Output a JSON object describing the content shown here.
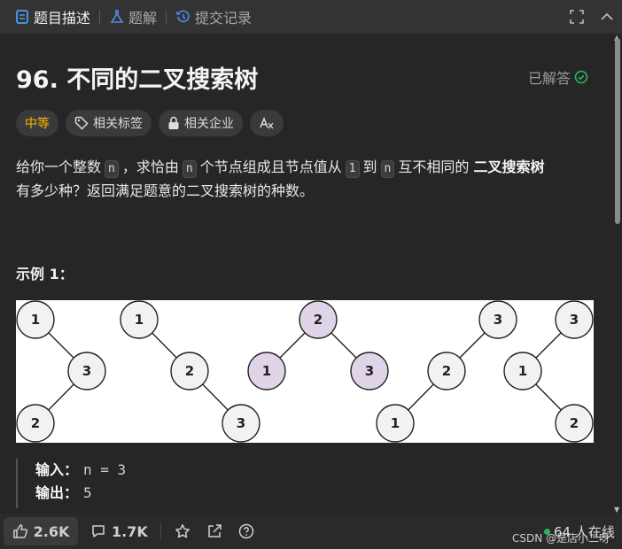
{
  "tabs": [
    {
      "label": "题目描述",
      "icon": "document-icon",
      "active": true
    },
    {
      "label": "题解",
      "icon": "flask-icon",
      "active": false
    },
    {
      "label": "提交记录",
      "icon": "history-icon",
      "active": false
    }
  ],
  "problem": {
    "title": "96. 不同的二叉搜索树",
    "status": "已解答",
    "tags": {
      "difficulty": "中等",
      "related_tags": "相关标签",
      "related_companies": "相关企业"
    },
    "description": {
      "p1": "给你一个整数",
      "n": "n",
      "p2": "，求恰由",
      "p3": "个节点组成且节点值从",
      "one": "1",
      "p4": "到",
      "p5": "互不相同的",
      "bold": "二叉搜索树",
      "p6": "有多少种？返回满足题意的二叉搜索树的种数。"
    },
    "example_title": "示例 1：",
    "figure_nodes": [
      "1",
      "3",
      "2",
      "1",
      "2",
      "3",
      "2",
      "1",
      "3",
      "3",
      "2",
      "1",
      "3",
      "1",
      "2"
    ],
    "input_label": "输入：",
    "input_value": "n = 3",
    "output_label": "输出：",
    "output_value": "5"
  },
  "bottom": {
    "likes": "2.6K",
    "comments": "1.7K",
    "online": "64 人在线"
  },
  "watermark": "CSDN @是店小二呀",
  "colors": {
    "difficulty": "#ffb800",
    "highlight_node": "#e0d4e8",
    "node_fill": "#f2f2f2",
    "online_dot": "#2db55d",
    "solved_check": "#2db55d"
  }
}
